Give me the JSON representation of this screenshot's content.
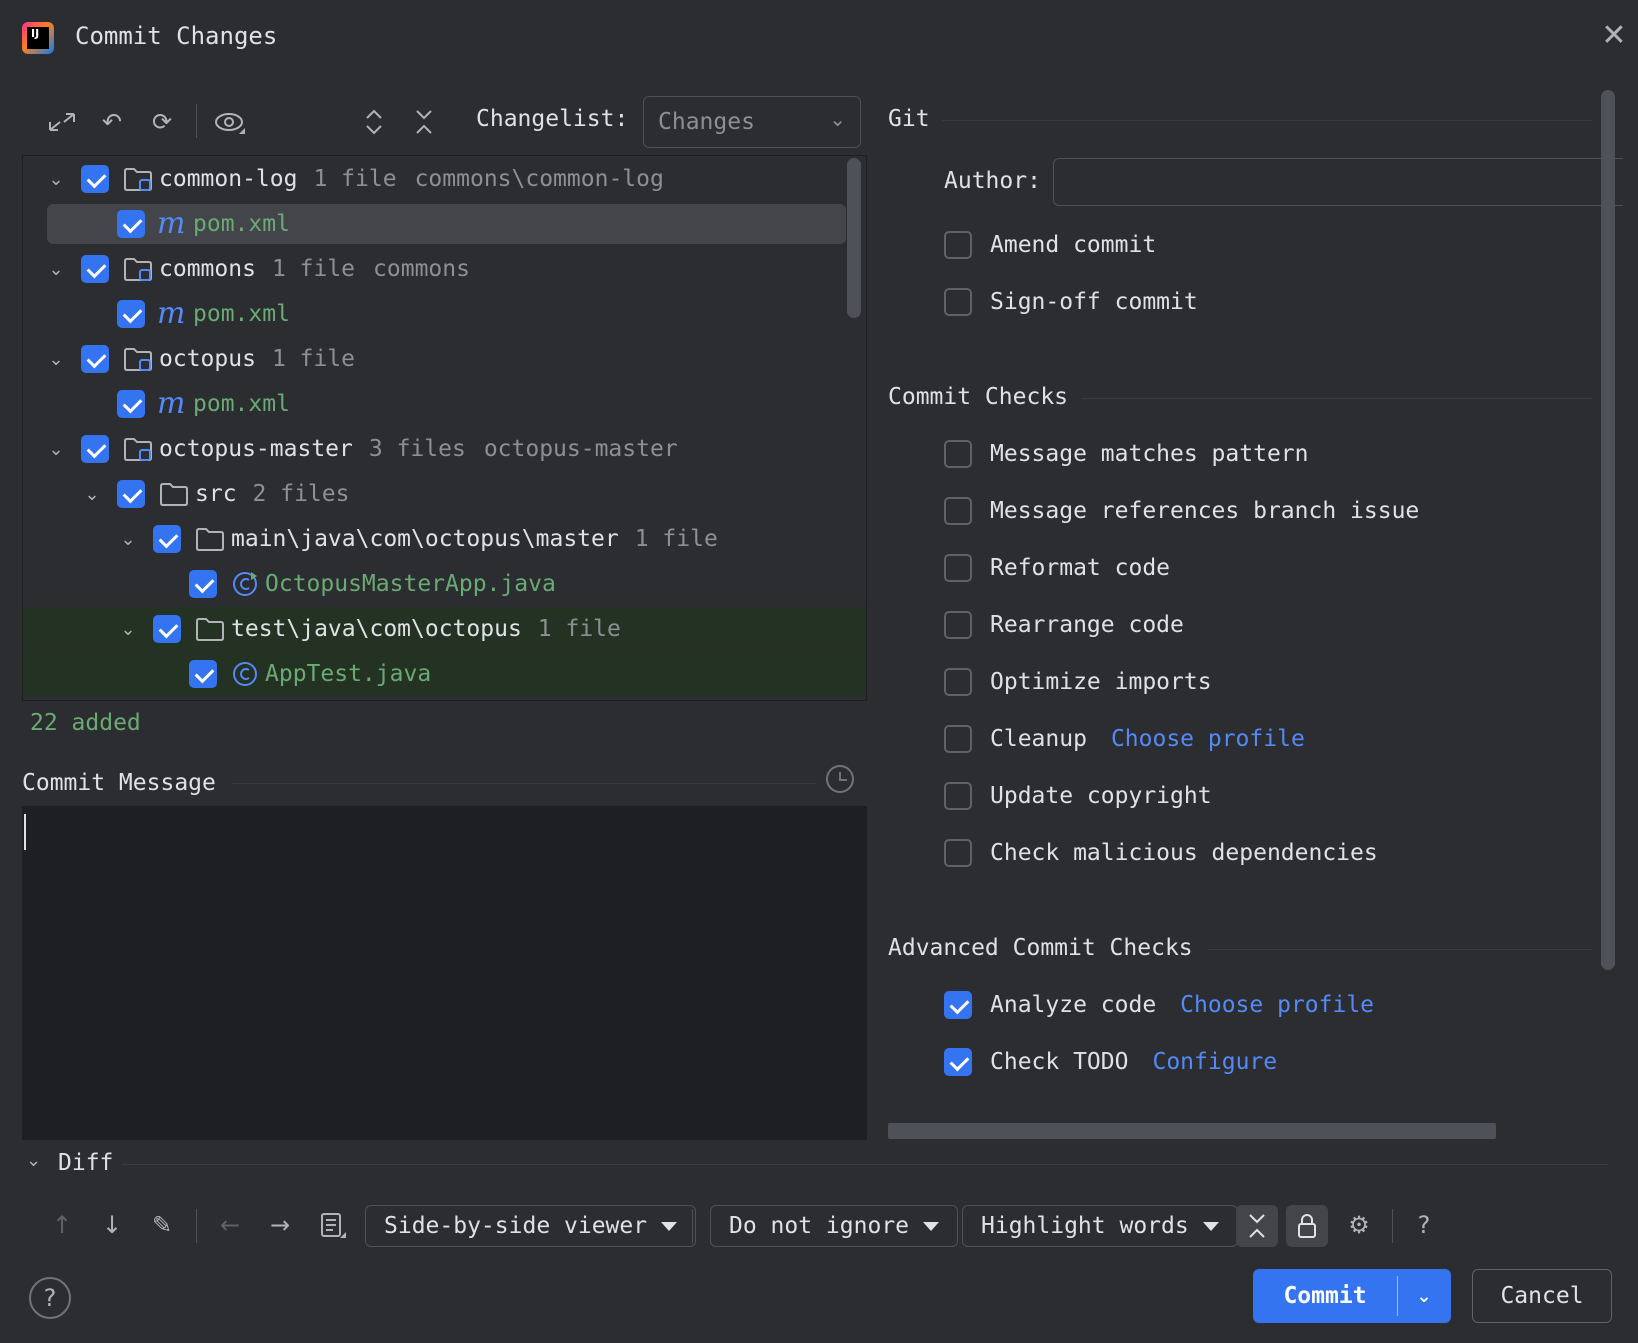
{
  "window": {
    "title": "Commit Changes"
  },
  "toolbar": {
    "changelist_label": "Changelist:",
    "changelist_value": "Changes"
  },
  "tree": [
    {
      "level": 0,
      "expanded": true,
      "checked": true,
      "icon": "folder-module-icon",
      "name": "common-log",
      "count": "1 file",
      "path": "commons\\common-log"
    },
    {
      "level": 1,
      "checked": true,
      "icon": "maven-icon",
      "name": "pom.xml",
      "selected": true
    },
    {
      "level": 0,
      "expanded": true,
      "checked": true,
      "icon": "folder-module-icon",
      "name": "commons",
      "count": "1 file",
      "path": "commons"
    },
    {
      "level": 1,
      "checked": true,
      "icon": "maven-icon",
      "name": "pom.xml"
    },
    {
      "level": 0,
      "expanded": true,
      "checked": true,
      "icon": "folder-module-icon",
      "name": "octopus",
      "count": "1 file",
      "path": ""
    },
    {
      "level": 1,
      "checked": true,
      "icon": "maven-icon",
      "name": "pom.xml"
    },
    {
      "level": 0,
      "expanded": true,
      "checked": true,
      "icon": "folder-module-icon",
      "name": "octopus-master",
      "count": "3 files",
      "path": "octopus-master"
    },
    {
      "level": 1,
      "expanded": true,
      "checked": true,
      "icon": "folder-icon",
      "name": "src",
      "count": "2 files",
      "path": ""
    },
    {
      "level": 2,
      "expanded": true,
      "checked": true,
      "icon": "folder-icon",
      "name": "main\\java\\com\\octopus\\master",
      "count": "1 file",
      "path": ""
    },
    {
      "level": 3,
      "checked": true,
      "icon": "java-class-run-icon",
      "name": "OctopusMasterApp.java"
    },
    {
      "level": 2,
      "expanded": true,
      "checked": true,
      "icon": "folder-icon",
      "name": "test\\java\\com\\octopus",
      "count": "1 file",
      "path": "",
      "highlight": true
    },
    {
      "level": 3,
      "checked": true,
      "icon": "java-class-icon",
      "name": "AppTest.java",
      "highlight": true
    }
  ],
  "status": {
    "added": "22 added"
  },
  "commit_message": {
    "label": "Commit Message",
    "value": ""
  },
  "git": {
    "title": "Git",
    "author_label": "Author:",
    "author_value": "",
    "options": [
      {
        "label": "Amend commit",
        "checked": false
      },
      {
        "label": "Sign-off commit",
        "checked": false
      }
    ]
  },
  "commit_checks": {
    "title": "Commit Checks",
    "options": [
      {
        "label": "Message matches pattern",
        "checked": false,
        "link": ""
      },
      {
        "label": "Message references branch issue",
        "checked": false,
        "link": ""
      },
      {
        "label": "Reformat code",
        "checked": false,
        "link": ""
      },
      {
        "label": "Rearrange code",
        "checked": false,
        "link": ""
      },
      {
        "label": "Optimize imports",
        "checked": false,
        "link": ""
      },
      {
        "label": "Cleanup",
        "checked": false,
        "link": "Choose profile"
      },
      {
        "label": "Update copyright",
        "checked": false,
        "link": ""
      },
      {
        "label": "Check malicious dependencies",
        "checked": false,
        "link": ""
      }
    ]
  },
  "advanced_checks": {
    "title": "Advanced Commit Checks",
    "options": [
      {
        "label": "Analyze code",
        "checked": true,
        "link": "Choose profile"
      },
      {
        "label": "Check TODO",
        "checked": true,
        "link": "Configure"
      }
    ]
  },
  "diff": {
    "label": "Diff",
    "viewer": "Side-by-side viewer",
    "ignore": "Do not ignore",
    "highlight": "Highlight words"
  },
  "footer": {
    "commit": "Commit",
    "cancel": "Cancel"
  },
  "colors": {
    "accent": "#3574f0",
    "added_green": "#6aab73",
    "link": "#548af7",
    "background": "#2b2d30"
  }
}
